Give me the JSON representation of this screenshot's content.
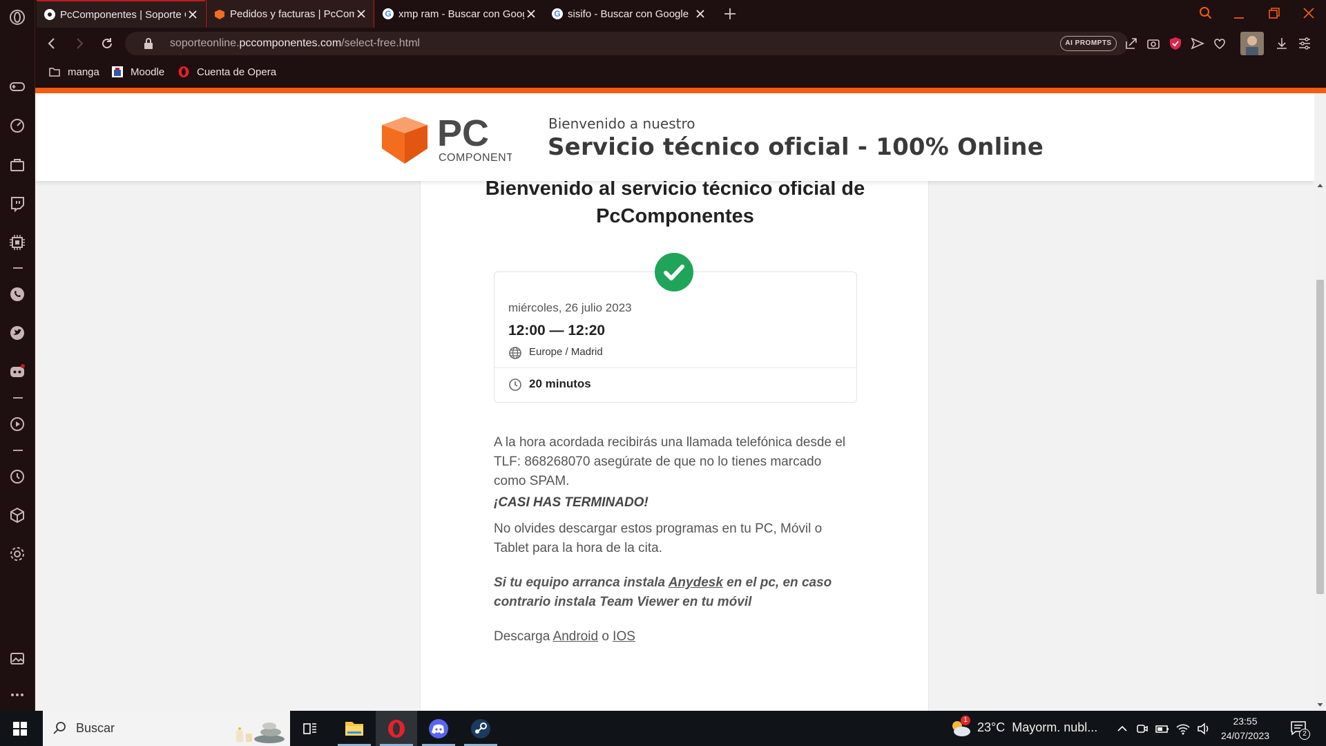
{
  "browser": {
    "tabs": [
      {
        "title": "PcComponentes | Soporte Online",
        "favicon": "pccomponentes-icon"
      },
      {
        "title": "Pedidos y facturas | PcComponentes",
        "favicon": "pccomponentes-box-icon"
      },
      {
        "title": "xmp ram - Buscar con Google",
        "favicon": "google-icon"
      },
      {
        "title": "sisifo - Buscar con Google",
        "favicon": "google-icon"
      }
    ],
    "url_domain_prefix": "soporteonline.",
    "url_domain_main": "pccomponentes.com",
    "url_path": "/select-free.html",
    "ai_prompts_label": "AI PROMPTS",
    "bookmarks": [
      "manga",
      "Moodle",
      "Cuenta de Opera"
    ],
    "accent_color": "#f45b13"
  },
  "header": {
    "logo_text": "PC",
    "logo_subtext": "COMPONENTES",
    "welcome_small": "Bienvenido a nuestro",
    "welcome_big": "Servicio técnico oficial - 100% Online"
  },
  "main": {
    "title": "Bienvenido al servicio técnico oficial de PcComponentes",
    "appointment": {
      "date": "miércoles, 26 julio 2023",
      "time": "12:00 — 12:20",
      "timezone": "Europe / Madrid",
      "duration": "20 minutos"
    },
    "para1": "A la hora acordada recibirás una llamada telefónica desde el TLF: 868268070 asegúrate de que no lo tienes marcado como SPAM.",
    "para2": "¡CASI HAS TERMINADO!",
    "para3": "No olvides descargar estos programas en tu PC, Móvil o Tablet para la hora de la cita.",
    "para4_a": "Si tu equipo arranca instala ",
    "para4_link": "Anydesk",
    "para4_b": " en el pc, en caso contrario instala Team Viewer en tu móvil",
    "para5_a": "Descarga ",
    "para5_link1": "Android",
    "para5_mid": " o ",
    "para5_link2": "IOS"
  },
  "taskbar": {
    "search_placeholder": "Buscar",
    "weather_temp": "23°C",
    "weather_desc": "Mayorm. nubl...",
    "weather_badge": "1",
    "time": "23:55",
    "date": "24/07/2023",
    "notification_count": "2"
  }
}
